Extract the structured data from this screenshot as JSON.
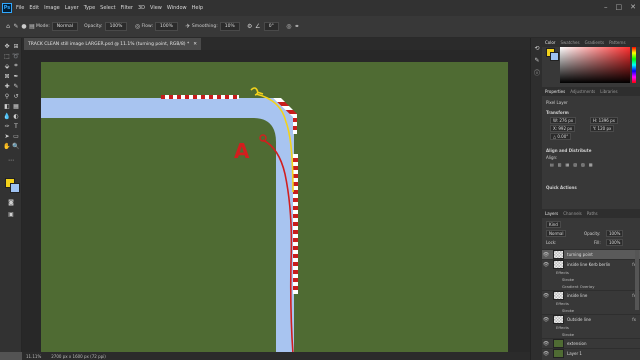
{
  "menubar": {
    "logo": "Ps",
    "items": [
      "File",
      "Edit",
      "Image",
      "Layer",
      "Type",
      "Select",
      "Filter",
      "3D",
      "View",
      "Window",
      "Help"
    ],
    "window_controls": {
      "minimize": "–",
      "maximize": "□",
      "close": "✕"
    }
  },
  "options_bar": {
    "mode_label": "Mode:",
    "mode_value": "Normal",
    "opacity_label": "Opacity:",
    "opacity_value": "100%",
    "flow_label": "Flow:",
    "flow_value": "100%",
    "smoothing_label": "Smoothing:",
    "smoothing_value": "10%",
    "angle_value": "0°"
  },
  "document_tab": {
    "title": "TRACK CLEAN still image LARGER.psd @ 11.1% (turning point, RGB/8) *",
    "close": "✕"
  },
  "canvas": {
    "annotation_letter": "A",
    "road_color": "#a8c4f0",
    "grass_color": "#4f6b33",
    "red_line_color": "#d21e1e",
    "yellow_line_color": "#f3d21b"
  },
  "statusbar": {
    "zoom": "11.11%",
    "doc_size": "2700 px x 1600 px (72 ppi)"
  },
  "color_panel": {
    "tabs": [
      "Color",
      "Swatches",
      "Gradients",
      "Patterns"
    ],
    "fg_color": "#f3d21b",
    "bg_color": "#9ec2f2"
  },
  "properties_panel": {
    "tabs": [
      "Properties",
      "Adjustments",
      "Libraries"
    ],
    "kind": "Pixel Layer",
    "transform_title": "Transform",
    "w": "W: 276 px",
    "h": "H: 1396 px",
    "x": "X: 992 px",
    "y": "Y: 120 px",
    "angle": "△ 0.00°",
    "align_title": "Align and Distribute",
    "align_label": "Align:",
    "quick_actions": "Quick Actions"
  },
  "layers_panel": {
    "tabs": [
      "Layers",
      "Channels",
      "Paths"
    ],
    "kind_label": "Kind",
    "blend_mode": "Normal",
    "opacity_label": "Opacity:",
    "opacity_value": "100%",
    "lock_label": "Lock:",
    "fill_label": "Fill:",
    "fill_value": "100%",
    "layers": [
      {
        "name": "turning point",
        "fx": ""
      },
      {
        "name": "inside line Kerb berlin",
        "fx": "fx"
      },
      {
        "name": "Effects",
        "fx": ""
      },
      {
        "name": "Stroke",
        "fx": ""
      },
      {
        "name": "Gradient Overlay",
        "fx": ""
      },
      {
        "name": "inside line",
        "fx": "fx"
      },
      {
        "name": "Effects",
        "fx": ""
      },
      {
        "name": "Stroke",
        "fx": ""
      },
      {
        "name": "Outside line",
        "fx": "fx"
      },
      {
        "name": "Effects",
        "fx": ""
      },
      {
        "name": "Stroke",
        "fx": ""
      },
      {
        "name": "extension",
        "fx": ""
      },
      {
        "name": "Layer 1",
        "fx": ""
      }
    ]
  }
}
